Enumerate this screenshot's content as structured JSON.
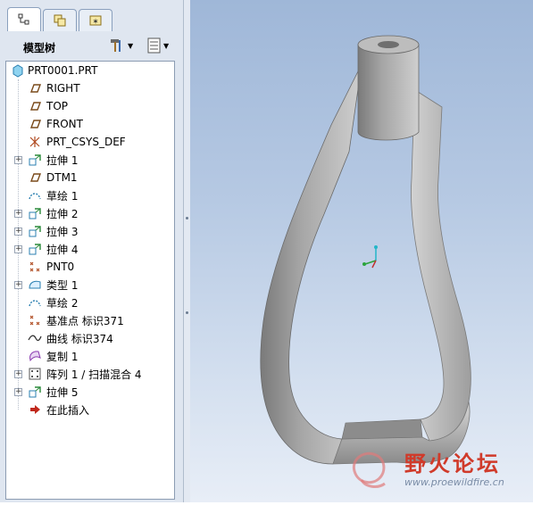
{
  "tabs": [
    {
      "name": "model-tree-tab",
      "icon": "model-tree-icon"
    },
    {
      "name": "layers-tab",
      "icon": "layers-icon"
    },
    {
      "name": "favorites-tab",
      "icon": "star-icon"
    }
  ],
  "header": {
    "title": "模型树",
    "settings_icon": "hammer-icon",
    "show_icon": "list-icon"
  },
  "tree": {
    "root": "PRT0001.PRT",
    "items": [
      {
        "label": "RIGHT",
        "icon": "datum-plane-icon",
        "expandable": false
      },
      {
        "label": "TOP",
        "icon": "datum-plane-icon",
        "expandable": false
      },
      {
        "label": "FRONT",
        "icon": "datum-plane-icon",
        "expandable": false
      },
      {
        "label": "PRT_CSYS_DEF",
        "icon": "csys-icon",
        "expandable": false
      },
      {
        "label": "拉伸 1",
        "icon": "extrude-icon",
        "expandable": true
      },
      {
        "label": "DTM1",
        "icon": "datum-plane-icon",
        "expandable": false
      },
      {
        "label": "草绘 1",
        "icon": "sketch-icon",
        "expandable": false
      },
      {
        "label": "拉伸 2",
        "icon": "extrude-icon",
        "expandable": true
      },
      {
        "label": "拉伸 3",
        "icon": "extrude-icon",
        "expandable": true
      },
      {
        "label": "拉伸 4",
        "icon": "extrude-icon",
        "expandable": true
      },
      {
        "label": "PNT0",
        "icon": "datum-point-icon",
        "expandable": false
      },
      {
        "label": "类型 1",
        "icon": "style-icon",
        "expandable": true
      },
      {
        "label": "草绘 2",
        "icon": "sketch-icon",
        "expandable": false
      },
      {
        "label": "基准点 标识371",
        "icon": "datum-point-icon",
        "expandable": false
      },
      {
        "label": "曲线 标识374",
        "icon": "curve-icon",
        "expandable": false
      },
      {
        "label": "复制 1",
        "icon": "copy-surface-icon",
        "expandable": false
      },
      {
        "label": "阵列 1 / 扫描混合 4",
        "icon": "pattern-icon",
        "expandable": true
      },
      {
        "label": "拉伸 5",
        "icon": "extrude-icon",
        "expandable": true
      },
      {
        "label": "在此插入",
        "icon": "insert-here-arrow-icon",
        "expandable": false
      }
    ]
  },
  "watermark": {
    "title": "野火论坛",
    "url": "www.proewildfire.cn"
  },
  "colors": {
    "panel_bg": "#dfe6f0",
    "viewport_top": "#9fb7d8",
    "viewport_bottom": "#e8eef7",
    "model_gray": "#9a9a9a",
    "insert_arrow": "#c0281c",
    "watermark_red": "#d03a2a",
    "watermark_green": "#3aa34a"
  }
}
